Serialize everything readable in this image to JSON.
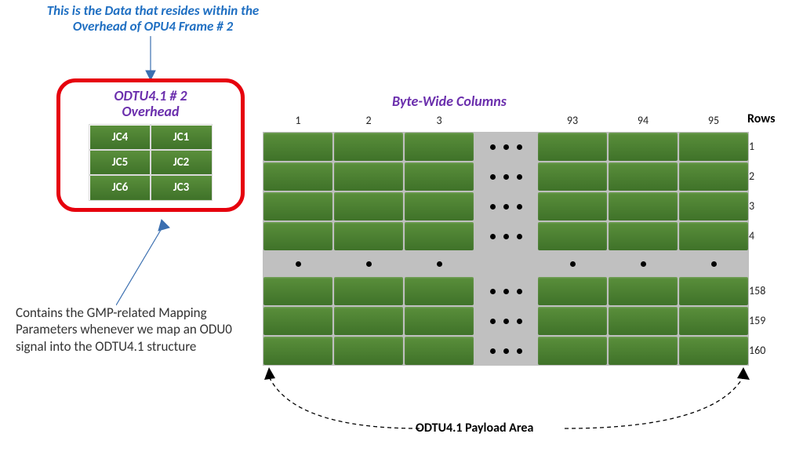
{
  "top_caption": "This is the Data that resides within the Overhead of OPU4 Frame # 2",
  "overhead": {
    "title_line1": "ODTU4.1 # 2",
    "title_line2": "Overhead",
    "cells": [
      [
        "JC4",
        "JC1"
      ],
      [
        "JC5",
        "JC2"
      ],
      [
        "JC6",
        "JC3"
      ]
    ]
  },
  "desc_caption": "Contains the GMP-related Mapping Parameters whenever we map an ODU0 signal into the ODTU4.1 structure",
  "cols_title": "Byte-Wide Columns",
  "col_labels": [
    "1",
    "2",
    "3",
    "93",
    "94",
    "95"
  ],
  "rows_title": "Rows",
  "row_labels_top": [
    "1",
    "2",
    "3",
    "4"
  ],
  "row_labels_bottom": [
    "158",
    "159",
    "160"
  ],
  "payload_label": "ODTU4.1 Payload Area"
}
